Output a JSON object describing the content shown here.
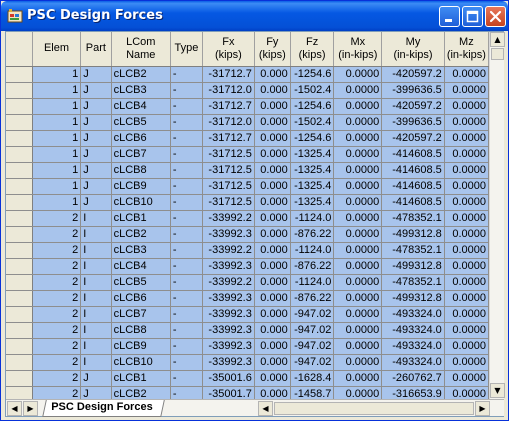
{
  "window": {
    "title": "PSC Design Forces"
  },
  "table": {
    "headers": [
      {
        "line1": "Elem",
        "line2": ""
      },
      {
        "line1": "Part",
        "line2": ""
      },
      {
        "line1": "LCom",
        "line2": "Name"
      },
      {
        "line1": "Type",
        "line2": ""
      },
      {
        "line1": "Fx",
        "line2": "(kips)"
      },
      {
        "line1": "Fy",
        "line2": "(kips)"
      },
      {
        "line1": "Fz",
        "line2": "(kips)"
      },
      {
        "line1": "Mx",
        "line2": "(in-kips)"
      },
      {
        "line1": "My",
        "line2": "(in-kips)"
      },
      {
        "line1": "Mz",
        "line2": "(in-kips)"
      }
    ],
    "rows": [
      [
        "1",
        "J",
        "cLCB2",
        "-",
        "-31712.7",
        "0.000",
        "-1254.6",
        "0.0000",
        "-420597.2",
        "0.0000"
      ],
      [
        "1",
        "J",
        "cLCB3",
        "-",
        "-31712.0",
        "0.000",
        "-1502.4",
        "0.0000",
        "-399636.5",
        "0.0000"
      ],
      [
        "1",
        "J",
        "cLCB4",
        "-",
        "-31712.7",
        "0.000",
        "-1254.6",
        "0.0000",
        "-420597.2",
        "0.0000"
      ],
      [
        "1",
        "J",
        "cLCB5",
        "-",
        "-31712.0",
        "0.000",
        "-1502.4",
        "0.0000",
        "-399636.5",
        "0.0000"
      ],
      [
        "1",
        "J",
        "cLCB6",
        "-",
        "-31712.7",
        "0.000",
        "-1254.6",
        "0.0000",
        "-420597.2",
        "0.0000"
      ],
      [
        "1",
        "J",
        "cLCB7",
        "-",
        "-31712.5",
        "0.000",
        "-1325.4",
        "0.0000",
        "-414608.5",
        "0.0000"
      ],
      [
        "1",
        "J",
        "cLCB8",
        "-",
        "-31712.5",
        "0.000",
        "-1325.4",
        "0.0000",
        "-414608.5",
        "0.0000"
      ],
      [
        "1",
        "J",
        "cLCB9",
        "-",
        "-31712.5",
        "0.000",
        "-1325.4",
        "0.0000",
        "-414608.5",
        "0.0000"
      ],
      [
        "1",
        "J",
        "cLCB10",
        "-",
        "-31712.5",
        "0.000",
        "-1325.4",
        "0.0000",
        "-414608.5",
        "0.0000"
      ],
      [
        "2",
        "I",
        "cLCB1",
        "-",
        "-33992.2",
        "0.000",
        "-1124.0",
        "0.0000",
        "-478352.1",
        "0.0000"
      ],
      [
        "2",
        "I",
        "cLCB2",
        "-",
        "-33992.3",
        "0.000",
        "-876.22",
        "0.0000",
        "-499312.8",
        "0.0000"
      ],
      [
        "2",
        "I",
        "cLCB3",
        "-",
        "-33992.2",
        "0.000",
        "-1124.0",
        "0.0000",
        "-478352.1",
        "0.0000"
      ],
      [
        "2",
        "I",
        "cLCB4",
        "-",
        "-33992.3",
        "0.000",
        "-876.22",
        "0.0000",
        "-499312.8",
        "0.0000"
      ],
      [
        "2",
        "I",
        "cLCB5",
        "-",
        "-33992.2",
        "0.000",
        "-1124.0",
        "0.0000",
        "-478352.1",
        "0.0000"
      ],
      [
        "2",
        "I",
        "cLCB6",
        "-",
        "-33992.3",
        "0.000",
        "-876.22",
        "0.0000",
        "-499312.8",
        "0.0000"
      ],
      [
        "2",
        "I",
        "cLCB7",
        "-",
        "-33992.3",
        "0.000",
        "-947.02",
        "0.0000",
        "-493324.0",
        "0.0000"
      ],
      [
        "2",
        "I",
        "cLCB8",
        "-",
        "-33992.3",
        "0.000",
        "-947.02",
        "0.0000",
        "-493324.0",
        "0.0000"
      ],
      [
        "2",
        "I",
        "cLCB9",
        "-",
        "-33992.3",
        "0.000",
        "-947.02",
        "0.0000",
        "-493324.0",
        "0.0000"
      ],
      [
        "2",
        "I",
        "cLCB10",
        "-",
        "-33992.3",
        "0.000",
        "-947.02",
        "0.0000",
        "-493324.0",
        "0.0000"
      ],
      [
        "2",
        "J",
        "cLCB1",
        "-",
        "-35001.6",
        "0.000",
        "-1628.4",
        "0.0000",
        "-260762.7",
        "0.0000"
      ],
      [
        "2",
        "J",
        "cLCB2",
        "-",
        "-35001.7",
        "0.000",
        "-1458.7",
        "0.0000",
        "-316653.9",
        "0.0000"
      ]
    ]
  },
  "sheet_tabs": [
    {
      "label": "PSC Design Forces"
    }
  ],
  "icons": {
    "app": "app-icon",
    "minimize": "minimize-icon",
    "maximize": "maximize-icon",
    "close": "close-icon",
    "scroll_up": "arrow-up-icon",
    "scroll_down": "arrow-down-icon",
    "first_tab": "arrow-first-icon",
    "last_tab": "arrow-last-icon",
    "scroll_left": "arrow-left-icon",
    "scroll_right": "arrow-right-icon"
  },
  "colors": {
    "title_bar": "#0558e3",
    "selection": "#a8c4ec",
    "close_button": "#c5431f"
  }
}
